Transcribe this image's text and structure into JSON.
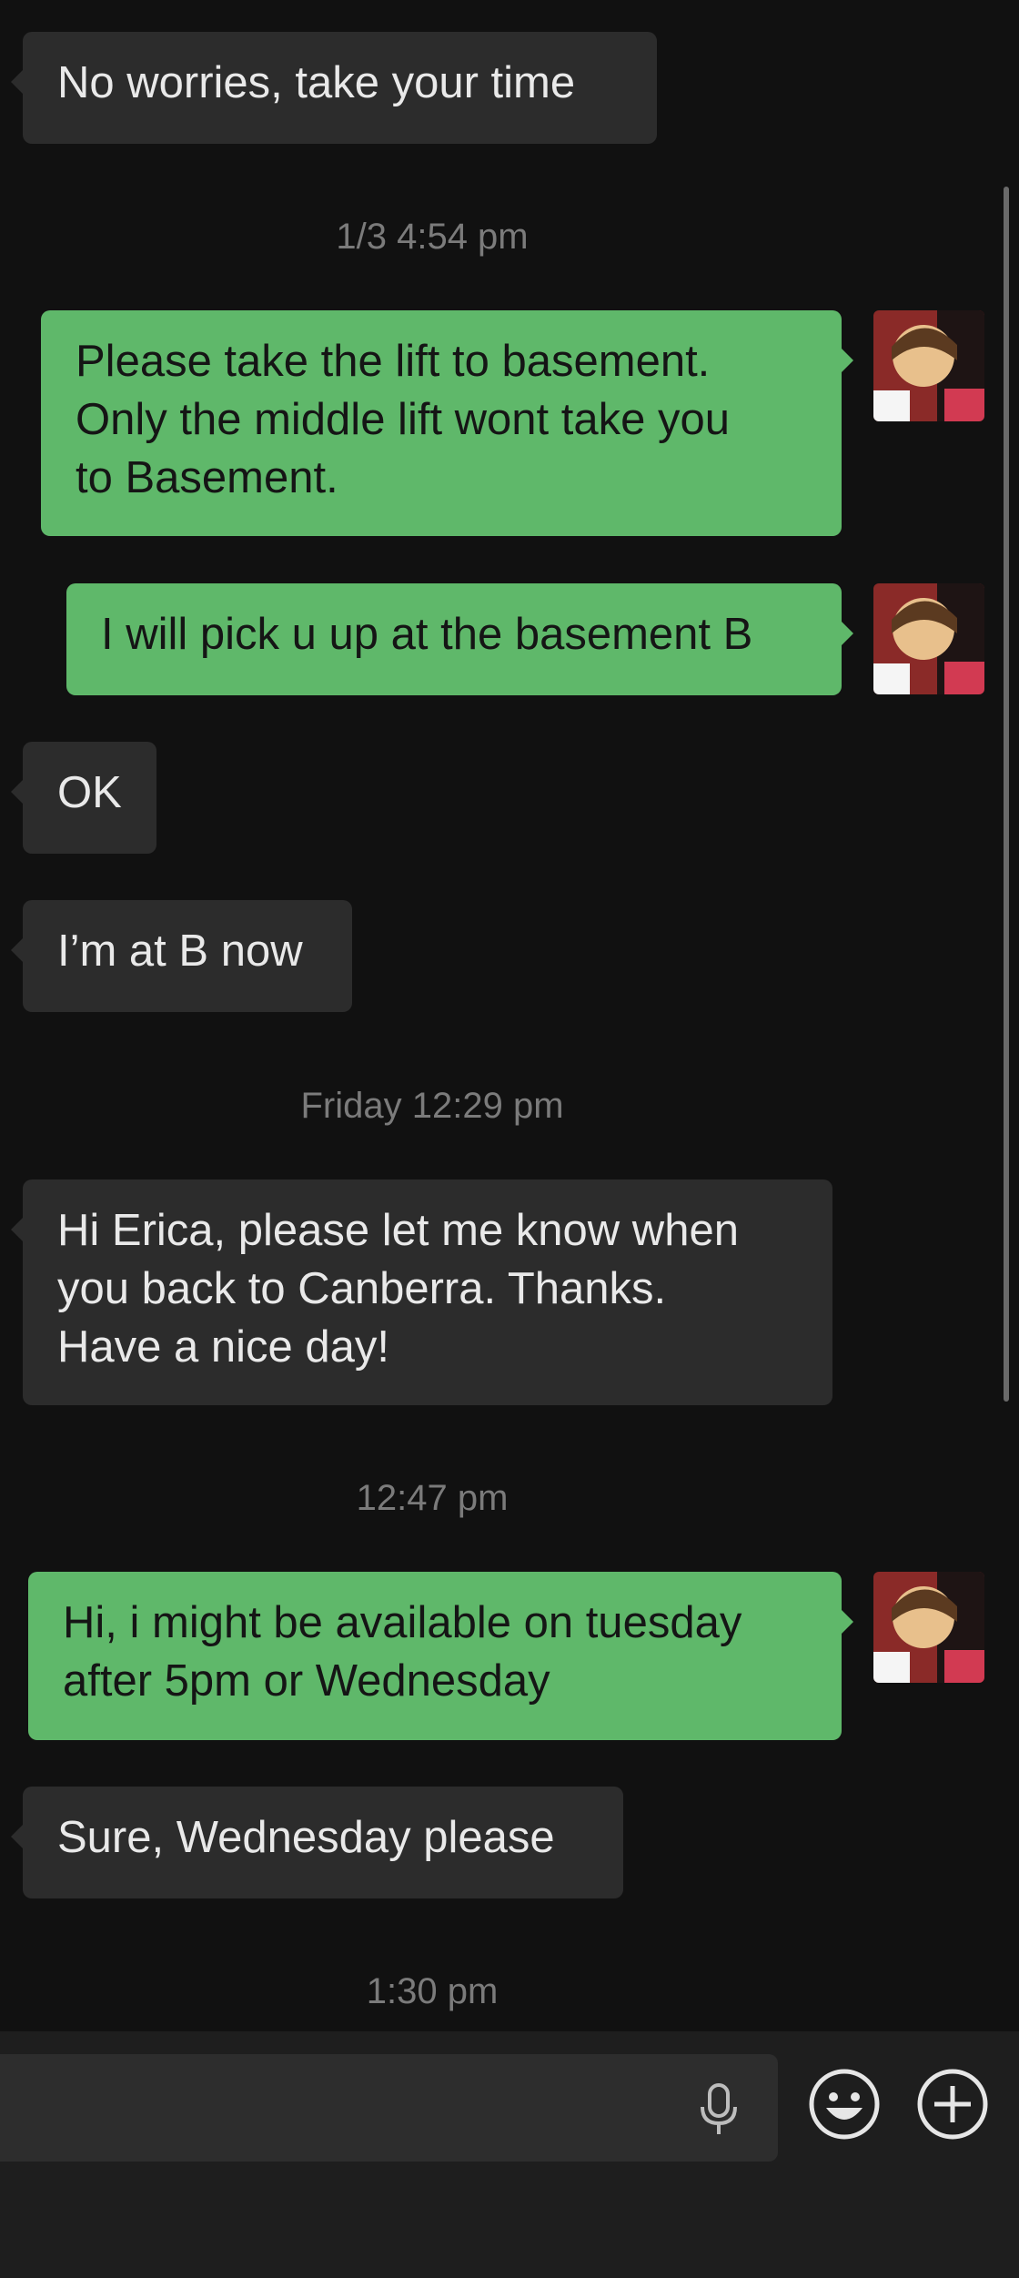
{
  "messages": [
    {
      "id": "m1",
      "side": "in",
      "text": "No worries, take your time"
    },
    {
      "id": "t1",
      "timestamp": "1/3 4:54 pm"
    },
    {
      "id": "m2",
      "side": "out",
      "text": "Please take the lift to basement.\nOnly the middle lift wont take you\nto Basement."
    },
    {
      "id": "m3",
      "side": "out",
      "text": "I will pick u up at the basement B"
    },
    {
      "id": "m4",
      "side": "in",
      "text": "OK"
    },
    {
      "id": "m5",
      "side": "in",
      "text": "I’m at B now"
    },
    {
      "id": "t2",
      "timestamp": "Friday 12:29 pm"
    },
    {
      "id": "m6",
      "side": "in",
      "text": "Hi Erica, please let me know when\nyou back to Canberra. Thanks.\nHave a nice day!"
    },
    {
      "id": "t3",
      "timestamp": "12:47 pm"
    },
    {
      "id": "m7",
      "side": "out",
      "text": "Hi, i might be available on tuesday\nafter 5pm or Wednesday"
    },
    {
      "id": "m8",
      "side": "in",
      "text": "Sure, Wednesday please"
    },
    {
      "id": "t4",
      "timestamp": "1:30 pm"
    }
  ],
  "input_bar": {
    "icons": [
      "microphone-icon",
      "emoji-icon",
      "plus-icon"
    ]
  },
  "colors": {
    "background": "#111111",
    "incoming_bubble": "#2c2c2c",
    "outgoing_bubble": "#5fb86a",
    "timestamp": "#7b7b7b"
  }
}
